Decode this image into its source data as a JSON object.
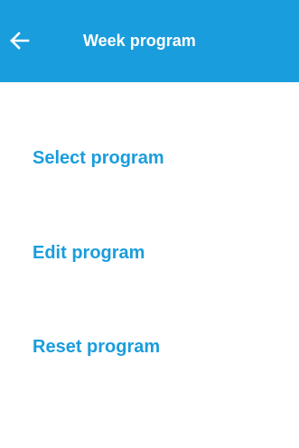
{
  "header": {
    "title": "Week program",
    "back_icon": "arrow-left-icon",
    "background_color": "#1a9ddc"
  },
  "menu": {
    "items": [
      {
        "label": "Select program"
      },
      {
        "label": "Edit program"
      },
      {
        "label": "Reset program"
      }
    ],
    "text_color": "#1a9ddc"
  }
}
